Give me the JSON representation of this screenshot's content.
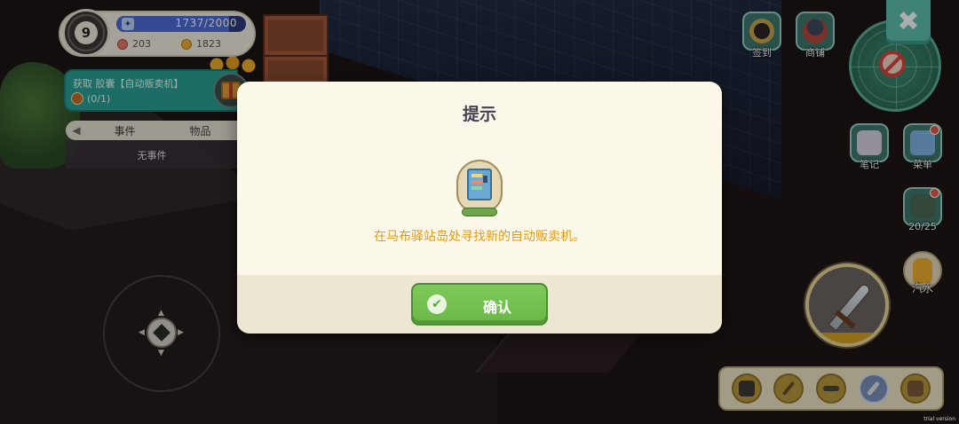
{
  "player": {
    "level": "9",
    "xp_text": "1737/2000",
    "xp_fraction": 0.8685,
    "currency_a": "203",
    "currency_b": "1823"
  },
  "quest": {
    "title": "获取 胶囊【自动贩卖机】",
    "progress": "(0/1)"
  },
  "event_panel": {
    "tab_events": "事件",
    "tab_items": "物品",
    "empty_text": "无事件"
  },
  "top_buttons": {
    "signin": "签到",
    "shop": "商铺"
  },
  "side_buttons": {
    "notes": "笔记",
    "menu": "菜单",
    "bag_count": "20/25",
    "soda": "汽水"
  },
  "hotbar": {
    "slots": [
      "axe",
      "fishing-rod",
      "pickaxe",
      "sword",
      "backpack"
    ],
    "selected_index": 3
  },
  "dialog": {
    "title": "提示",
    "description": "在马布驿站岛处寻找新的自动贩卖机。",
    "confirm_label": "确认",
    "item_icon": "vending-machine-icon"
  },
  "watermark": "trial version",
  "colors": {
    "accent_green": "#6ab748",
    "dialog_bg": "#fbf8ea",
    "desc_orange": "#e09a1b",
    "teal": "#2aa196"
  }
}
